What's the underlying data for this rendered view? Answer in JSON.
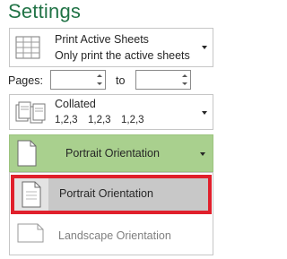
{
  "header": {
    "title": "Settings"
  },
  "print_what": {
    "title": "Print Active Sheets",
    "subtitle": "Only print the active sheets"
  },
  "pages": {
    "label": "Pages:",
    "to_label": "to",
    "from_value": "",
    "to_value": ""
  },
  "collation": {
    "title": "Collated",
    "sequence": [
      "1,2,3",
      "1,2,3",
      "1,2,3"
    ]
  },
  "orientation": {
    "selected": "Portrait Orientation",
    "options": [
      "Portrait Orientation",
      "Landscape Orientation"
    ]
  },
  "colors": {
    "accent_green": "#217346",
    "selected_bg": "#a9d08e",
    "highlight_border": "#e0202c"
  },
  "icons": [
    "sheets-icon",
    "collate-icon",
    "portrait-page-icon",
    "landscape-page-icon",
    "chevron-down-icon"
  ]
}
